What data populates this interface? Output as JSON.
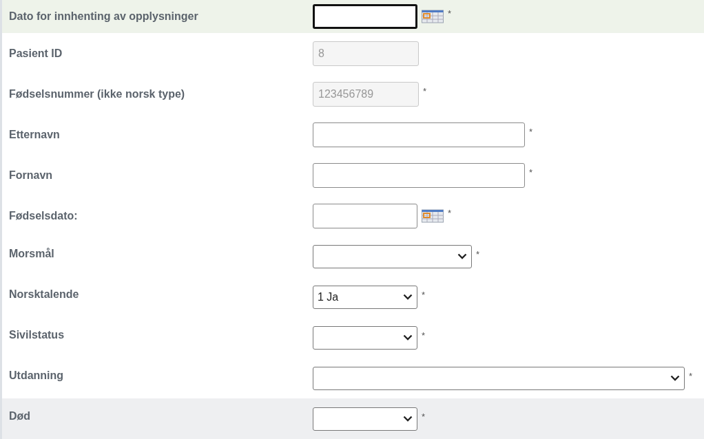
{
  "rows": [
    {
      "label": "Dato for innhenting av opplysninger",
      "kind": "date",
      "value": "",
      "required": true,
      "disabled": false,
      "focused": true,
      "hovered": false
    },
    {
      "label": "Pasient ID",
      "kind": "shorttext",
      "value": "8",
      "required": false,
      "disabled": true,
      "focused": false,
      "hovered": false
    },
    {
      "label": "Fødselsnummer (ikke norsk type)",
      "kind": "shorttext",
      "value": "123456789",
      "required": true,
      "disabled": true,
      "focused": false,
      "hovered": false
    },
    {
      "label": "Etternavn",
      "kind": "longtext",
      "value": "",
      "required": true,
      "disabled": false,
      "focused": false,
      "hovered": false
    },
    {
      "label": "Fornavn",
      "kind": "longtext",
      "value": "",
      "required": true,
      "disabled": false,
      "focused": false,
      "hovered": false
    },
    {
      "label": "Fødselsdato:",
      "kind": "date",
      "value": "",
      "required": true,
      "disabled": false,
      "focused": false,
      "hovered": false
    },
    {
      "label": "Morsmål",
      "kind": "select",
      "value": "",
      "required": true,
      "disabled": false,
      "focused": false,
      "hovered": false
    },
    {
      "label": "Norsktalende",
      "kind": "shortselect",
      "value": "1 Ja",
      "required": true,
      "disabled": false,
      "focused": false,
      "hovered": false
    },
    {
      "label": "Sivilstatus",
      "kind": "shortselect",
      "value": "",
      "required": true,
      "disabled": false,
      "focused": false,
      "hovered": false
    },
    {
      "label": "Utdanning",
      "kind": "longselect",
      "value": "",
      "required": true,
      "disabled": false,
      "focused": false,
      "hovered": false
    },
    {
      "label": "Død",
      "kind": "shortselect",
      "value": "",
      "required": true,
      "disabled": false,
      "focused": false,
      "hovered": true
    }
  ],
  "required_mark": "*"
}
